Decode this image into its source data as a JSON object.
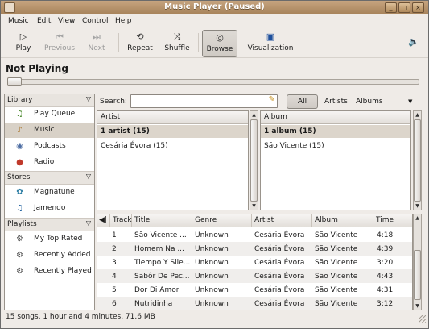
{
  "window": {
    "title": "Music Player (Paused)"
  },
  "menu": [
    "Music",
    "Edit",
    "View",
    "Control",
    "Help"
  ],
  "toolbar": {
    "play": "Play",
    "previous": "Previous",
    "next": "Next",
    "repeat": "Repeat",
    "shuffle": "Shuffle",
    "browse": "Browse",
    "visualization": "Visualization"
  },
  "now_playing": "Not Playing",
  "sidebar": {
    "library_header": "Library",
    "library_items": [
      "Play Queue",
      "Music",
      "Podcasts",
      "Radio"
    ],
    "stores_header": "Stores",
    "stores_items": [
      "Magnatune",
      "Jamendo"
    ],
    "playlists_header": "Playlists",
    "playlists_items": [
      "My Top Rated",
      "Recently Added",
      "Recently Played"
    ]
  },
  "search": {
    "label": "Search:",
    "value": "",
    "all_button": "All",
    "artists_link": "Artists",
    "albums_link": "Albums"
  },
  "artist_pane": {
    "header": "Artist",
    "rows": [
      "1 artist (15)",
      "Cesária Évora (15)"
    ]
  },
  "album_pane": {
    "header": "Album",
    "rows": [
      "1 album (15)",
      "São Vicente (15)"
    ]
  },
  "tracks": {
    "columns": [
      "Track",
      "Title",
      "Genre",
      "Artist",
      "Album",
      "Time"
    ],
    "rows": [
      [
        "1",
        "São Vicente ...",
        "Unknown",
        "Cesária Évora",
        "São Vicente",
        "4:18"
      ],
      [
        "2",
        "Homem Na ...",
        "Unknown",
        "Cesária Évora",
        "São Vicente",
        "4:39"
      ],
      [
        "3",
        "Tiempo Y Sile...",
        "Unknown",
        "Cesária Évora",
        "São Vicente",
        "3:20"
      ],
      [
        "4",
        "Sabôr De Pec...",
        "Unknown",
        "Cesária Évora",
        "São Vicente",
        "4:43"
      ],
      [
        "5",
        "Dor Di Amor",
        "Unknown",
        "Cesária Évora",
        "São Vicente",
        "4:31"
      ],
      [
        "6",
        "Nutridinha",
        "Unknown",
        "Cesária Évora",
        "São Vicente",
        "3:12"
      ]
    ]
  },
  "status": "15 songs, 1 hour and 4 minutes, 71.6 MB",
  "playback_position": 0
}
